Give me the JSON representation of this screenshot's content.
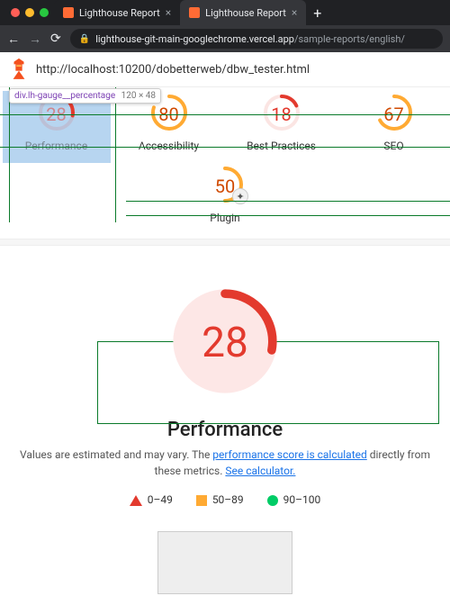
{
  "browser": {
    "tabs": [
      {
        "title": "Lighthouse Report",
        "active": false
      },
      {
        "title": "Lighthouse Report",
        "active": true
      }
    ],
    "url_host": "lighthouse-git-main-googlechrome.vercel.app",
    "url_path": "/sample-reports/english/"
  },
  "report": {
    "url": "http://localhost:10200/dobetterweb/dbw_tester.html",
    "gauges": [
      {
        "id": "performance",
        "label": "Performance",
        "score": 28,
        "class": "red",
        "color": "#e33a2e",
        "frac": 0.28,
        "selected": true
      },
      {
        "id": "accessibility",
        "label": "Accessibility",
        "score": 80,
        "class": "orange",
        "color": "#fa3",
        "frac": 0.8
      },
      {
        "id": "best-practices",
        "label": "Best Practices",
        "score": 18,
        "class": "red",
        "color": "#e33a2e",
        "frac": 0.18
      },
      {
        "id": "seo",
        "label": "SEO",
        "score": 67,
        "class": "orange",
        "color": "#fa3",
        "frac": 0.67
      },
      {
        "id": "plugin",
        "label": "Plugin",
        "score": 50,
        "class": "orange",
        "color": "#fa3",
        "frac": 0.5,
        "plugin": true
      }
    ],
    "devtools_tooltip": {
      "selector": "div.lh-gauge__percentage",
      "dims": "120 × 48"
    },
    "big": {
      "score": 28,
      "title": "Performance",
      "frac": 0.28,
      "color": "#e33a2e"
    },
    "desc_pre": "Values are estimated and may vary. The ",
    "desc_link1": "performance score is calculated",
    "desc_mid": " directly from these metrics. ",
    "desc_link2": "See calculator.",
    "legend": [
      {
        "range": "0–49"
      },
      {
        "range": "50–89"
      },
      {
        "range": "90–100"
      }
    ]
  }
}
